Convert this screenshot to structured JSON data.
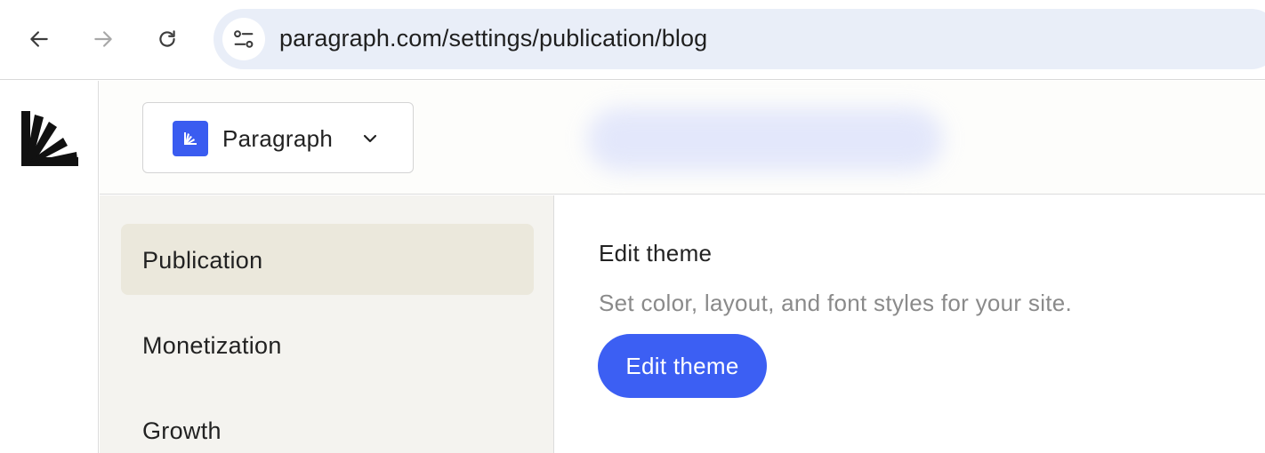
{
  "browser": {
    "url": "paragraph.com/settings/publication/blog",
    "icons": {
      "back": "back-arrow-icon",
      "forward": "forward-arrow-icon",
      "reload": "reload-icon",
      "site_info": "tune-icon"
    }
  },
  "app": {
    "logo": "paragraph-logo",
    "publication_switcher": {
      "name": "Paragraph",
      "avatar_color": "#3a5cf0",
      "chevron": "chevron-down-icon"
    }
  },
  "settings_menu": {
    "items": [
      {
        "label": "Publication",
        "active": true
      },
      {
        "label": "Monetization",
        "active": false
      },
      {
        "label": "Growth",
        "active": false
      }
    ]
  },
  "main": {
    "theme": {
      "title": "Edit theme",
      "description": "Set color, layout, and font styles for your site.",
      "button_label": "Edit theme",
      "button_color": "#3c5ff3"
    }
  }
}
